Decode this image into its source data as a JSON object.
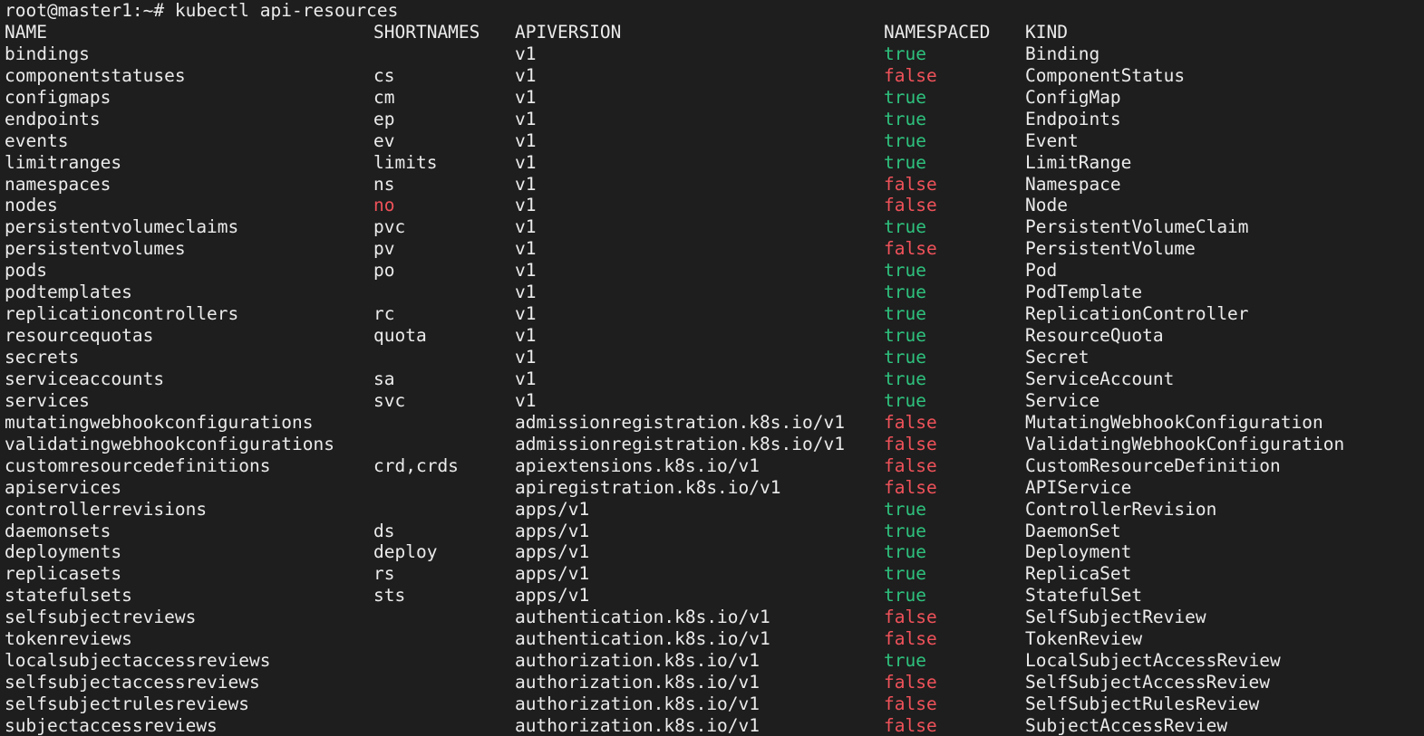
{
  "prompt": "root@master1:~# kubectl api-resources",
  "colors": {
    "background": "#1e1e1e",
    "foreground": "#ebebeb",
    "true": "#2ec27e",
    "false": "#f0525a"
  },
  "headers": {
    "name": "NAME",
    "shortnames": "SHORTNAMES",
    "apiversion": "APIVERSION",
    "namespaced": "NAMESPACED",
    "kind": "KIND"
  },
  "rows": [
    {
      "name": "bindings",
      "short": "",
      "api": "v1",
      "ns": "true",
      "kind": "Binding"
    },
    {
      "name": "componentstatuses",
      "short": "cs",
      "api": "v1",
      "ns": "false",
      "kind": "ComponentStatus"
    },
    {
      "name": "configmaps",
      "short": "cm",
      "api": "v1",
      "ns": "true",
      "kind": "ConfigMap"
    },
    {
      "name": "endpoints",
      "short": "ep",
      "api": "v1",
      "ns": "true",
      "kind": "Endpoints"
    },
    {
      "name": "events",
      "short": "ev",
      "api": "v1",
      "ns": "true",
      "kind": "Event"
    },
    {
      "name": "limitranges",
      "short": "limits",
      "api": "v1",
      "ns": "true",
      "kind": "LimitRange"
    },
    {
      "name": "namespaces",
      "short": "ns",
      "api": "v1",
      "ns": "false",
      "kind": "Namespace"
    },
    {
      "name": "nodes",
      "short": "no",
      "short_color": "red",
      "api": "v1",
      "ns": "false",
      "kind": "Node"
    },
    {
      "name": "persistentvolumeclaims",
      "short": "pvc",
      "api": "v1",
      "ns": "true",
      "kind": "PersistentVolumeClaim"
    },
    {
      "name": "persistentvolumes",
      "short": "pv",
      "api": "v1",
      "ns": "false",
      "kind": "PersistentVolume"
    },
    {
      "name": "pods",
      "short": "po",
      "api": "v1",
      "ns": "true",
      "kind": "Pod"
    },
    {
      "name": "podtemplates",
      "short": "",
      "api": "v1",
      "ns": "true",
      "kind": "PodTemplate"
    },
    {
      "name": "replicationcontrollers",
      "short": "rc",
      "api": "v1",
      "ns": "true",
      "kind": "ReplicationController"
    },
    {
      "name": "resourcequotas",
      "short": "quota",
      "api": "v1",
      "ns": "true",
      "kind": "ResourceQuota"
    },
    {
      "name": "secrets",
      "short": "",
      "api": "v1",
      "ns": "true",
      "kind": "Secret"
    },
    {
      "name": "serviceaccounts",
      "short": "sa",
      "api": "v1",
      "ns": "true",
      "kind": "ServiceAccount"
    },
    {
      "name": "services",
      "short": "svc",
      "api": "v1",
      "ns": "true",
      "kind": "Service"
    },
    {
      "name": "mutatingwebhookconfigurations",
      "short": "",
      "api": "admissionregistration.k8s.io/v1",
      "ns": "false",
      "kind": "MutatingWebhookConfiguration"
    },
    {
      "name": "validatingwebhookconfigurations",
      "short": "",
      "api": "admissionregistration.k8s.io/v1",
      "ns": "false",
      "kind": "ValidatingWebhookConfiguration"
    },
    {
      "name": "customresourcedefinitions",
      "short": "crd,crds",
      "api": "apiextensions.k8s.io/v1",
      "ns": "false",
      "kind": "CustomResourceDefinition"
    },
    {
      "name": "apiservices",
      "short": "",
      "api": "apiregistration.k8s.io/v1",
      "ns": "false",
      "kind": "APIService"
    },
    {
      "name": "controllerrevisions",
      "short": "",
      "api": "apps/v1",
      "ns": "true",
      "kind": "ControllerRevision"
    },
    {
      "name": "daemonsets",
      "short": "ds",
      "api": "apps/v1",
      "ns": "true",
      "kind": "DaemonSet"
    },
    {
      "name": "deployments",
      "short": "deploy",
      "api": "apps/v1",
      "ns": "true",
      "kind": "Deployment"
    },
    {
      "name": "replicasets",
      "short": "rs",
      "api": "apps/v1",
      "ns": "true",
      "kind": "ReplicaSet"
    },
    {
      "name": "statefulsets",
      "short": "sts",
      "api": "apps/v1",
      "ns": "true",
      "kind": "StatefulSet"
    },
    {
      "name": "selfsubjectreviews",
      "short": "",
      "api": "authentication.k8s.io/v1",
      "ns": "false",
      "kind": "SelfSubjectReview"
    },
    {
      "name": "tokenreviews",
      "short": "",
      "api": "authentication.k8s.io/v1",
      "ns": "false",
      "kind": "TokenReview"
    },
    {
      "name": "localsubjectaccessreviews",
      "short": "",
      "api": "authorization.k8s.io/v1",
      "ns": "true",
      "kind": "LocalSubjectAccessReview"
    },
    {
      "name": "selfsubjectaccessreviews",
      "short": "",
      "api": "authorization.k8s.io/v1",
      "ns": "false",
      "kind": "SelfSubjectAccessReview"
    },
    {
      "name": "selfsubjectrulesreviews",
      "short": "",
      "api": "authorization.k8s.io/v1",
      "ns": "false",
      "kind": "SelfSubjectRulesReview"
    },
    {
      "name": "subjectaccessreviews",
      "short": "",
      "api": "authorization.k8s.io/v1",
      "ns": "false",
      "kind": "SubjectAccessReview"
    }
  ]
}
